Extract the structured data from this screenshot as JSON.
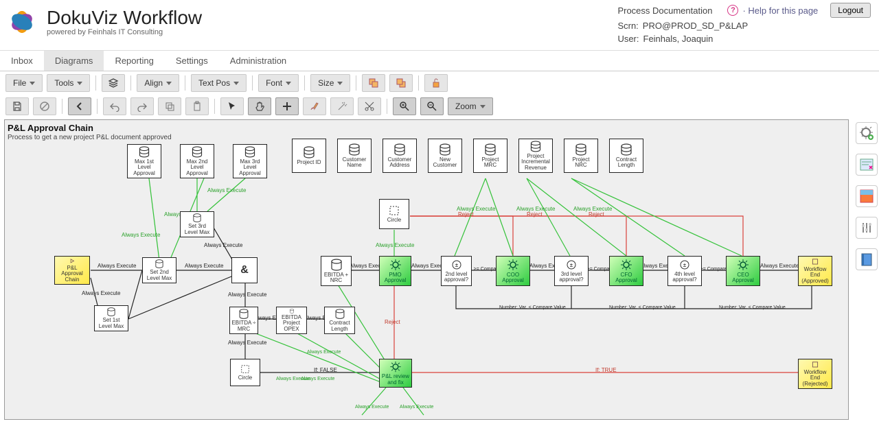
{
  "app": {
    "title": "DokuViz Workflow",
    "subtitle": "powered by Feinhals IT Consulting"
  },
  "header": {
    "proc_doc": "Process Documentation",
    "help_label": " · Help for this page",
    "scrn_label": "Scrn:",
    "scrn_value": "PRO@PROD_SD_P&LAP",
    "user_label": "User:",
    "user_value": "Feinhals, Joaquin",
    "logout": "Logout"
  },
  "nav": [
    "Inbox",
    "Diagrams",
    "Reporting",
    "Settings",
    "Administration"
  ],
  "nav_selected": 1,
  "toolbar1": {
    "file": "File",
    "tools": "Tools",
    "align": "Align",
    "textpos": "Text Pos",
    "font": "Font",
    "size": "Size"
  },
  "toolbar2": {
    "zoom": "Zoom"
  },
  "canvas": {
    "title": "P&L Approval Chain",
    "subtitle": "Process to get a new project P&L document approved"
  },
  "nodes": {
    "start": "P&L Approval Chain",
    "max1": "Max 1st Level Approval",
    "max2": "Max 2nd Level Approval",
    "max3": "Max 3rd Level Approval",
    "projid": "Project ID",
    "custname": "Customer Name",
    "custaddr": "Customer Address",
    "newcust": "New Customer",
    "projmrc": "Project MRC",
    "projincrev": "Project Incremental Revenue",
    "projnrc": "Project NRC",
    "contractlen": "Contract Length",
    "set3": "Set 3rd Level Max",
    "set2": "Set 2nd Level Max",
    "set1": "Set 1st Level Max",
    "and": "&",
    "circle1": "Circle",
    "circle2": "Circle",
    "ebitnrc": "EBITDA + NRC",
    "ebitmrc": "EBITDA ÷ MRC",
    "ebitopex": "EBITDA Project OPEX",
    "ebitlen": "Contract Length",
    "pmo": "PMO Approval",
    "lvl2": "2nd level approval?",
    "coo": "COO Approval",
    "lvl3": "3rd level approval?",
    "cfo": "CFO Approval",
    "lvl4": "4th level approval?",
    "ceo": "CEO Approval",
    "fix": "P&L review and fix",
    "endok": "Workflow End (Approved)",
    "endrej": "Workflow End (Rejected)"
  },
  "edges": {
    "always": "Always Execute",
    "reject": "Reject",
    "numge": "Number: Var. >= Compare Value",
    "numlt": "Number: Var. < Compare Value",
    "iffalse": "If: FALSE",
    "iftrue": "If: TRUE"
  }
}
